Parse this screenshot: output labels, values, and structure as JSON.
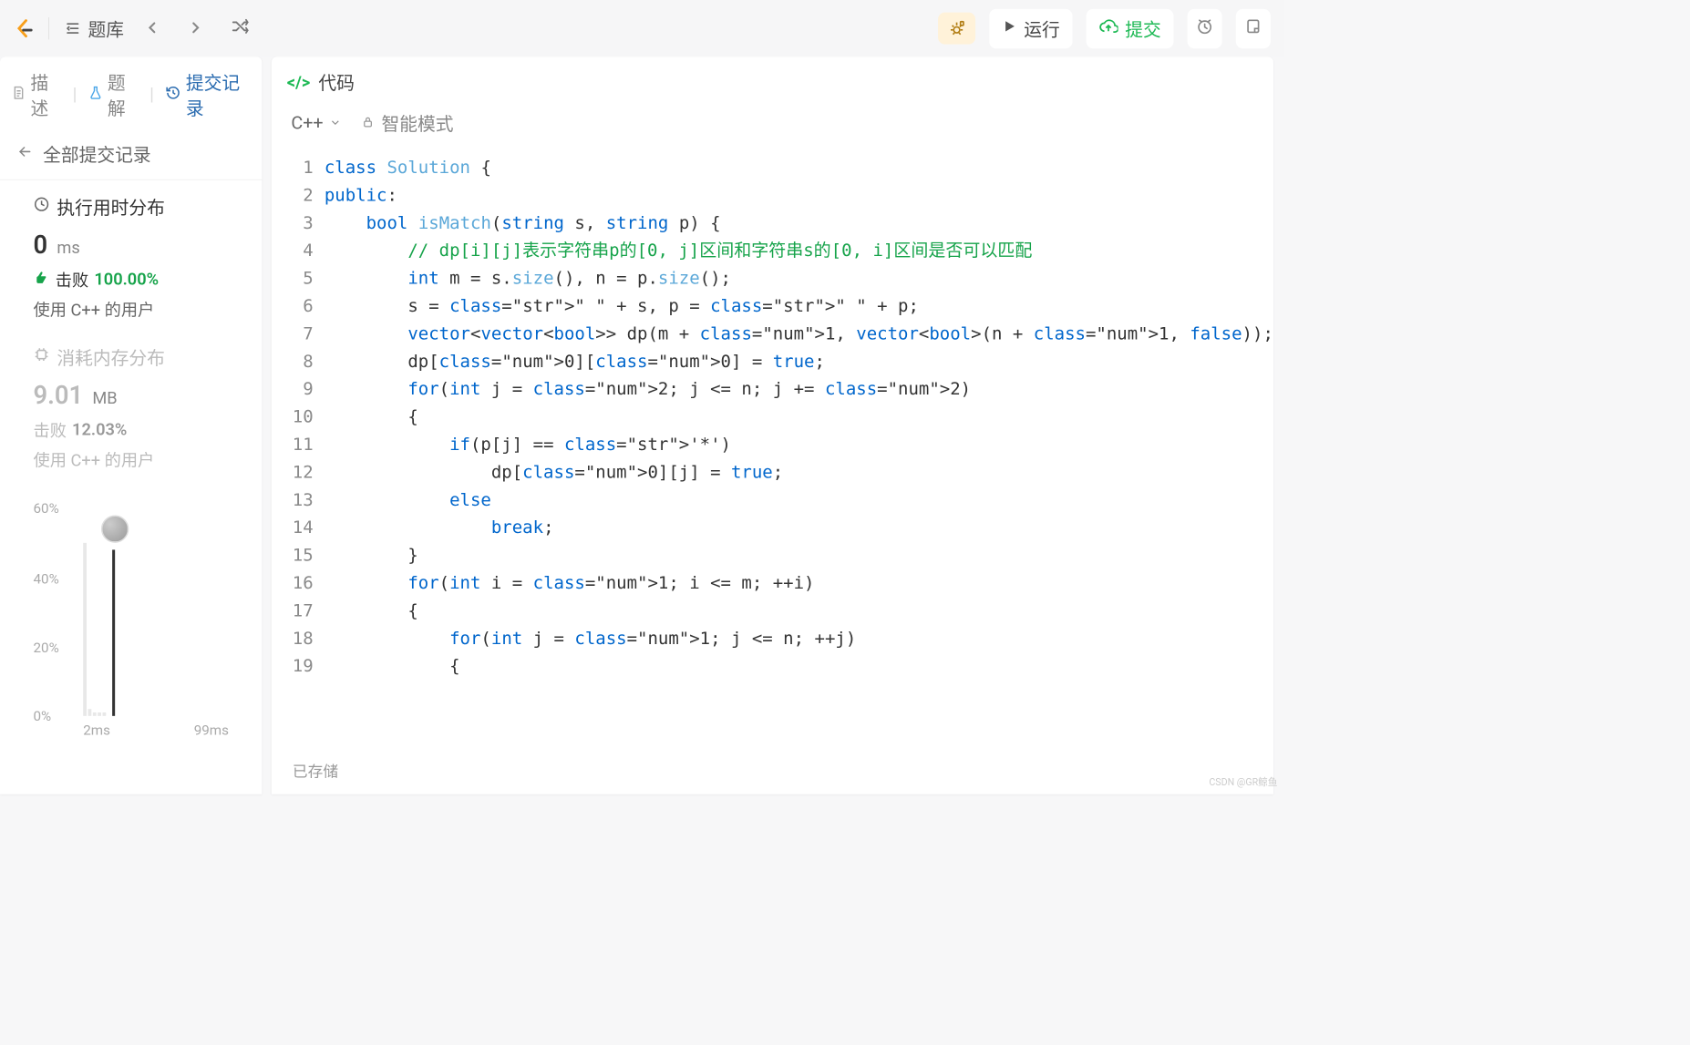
{
  "toolbar": {
    "problemset_label": "题库",
    "run_label": "运行",
    "submit_label": "提交"
  },
  "tabs": {
    "desc": "描述",
    "solution": "题解",
    "history": "提交记录"
  },
  "subheader": {
    "back_label": "全部提交记录"
  },
  "runtime": {
    "title": "执行用时分布",
    "value": "0",
    "unit": "ms",
    "beat_prefix": "击败",
    "beat_pct": "100.00%",
    "beat_suffix": "使用 C++ 的用户"
  },
  "memory": {
    "title": "消耗内存分布",
    "value": "9.01",
    "unit": "MB",
    "beat_prefix": "击败",
    "beat_pct": "12.03%",
    "beat_suffix": "使用 C++ 的用户"
  },
  "chart_data": {
    "type": "bar",
    "categories": [
      "2ms",
      "99ms"
    ],
    "values": [
      50,
      2,
      1,
      1,
      1,
      0,
      0,
      0,
      0,
      0,
      0,
      0,
      0,
      0,
      0,
      0,
      0,
      0,
      0,
      0,
      0,
      0,
      0,
      0,
      0,
      0,
      0,
      0,
      0,
      0
    ],
    "title": "执行用时分布",
    "xlabel": "",
    "ylabel": "",
    "ylim": [
      0,
      60
    ],
    "yticks": [
      "0%",
      "20%",
      "40%",
      "60%"
    ],
    "marker": {
      "x": "2ms",
      "pct": 50
    }
  },
  "code_panel": {
    "header": "代码",
    "language": "C++",
    "mode": "智能模式",
    "status": "已存储"
  },
  "code": {
    "lines": [
      {
        "n": 1,
        "plain": "class Solution {"
      },
      {
        "n": 2,
        "plain": "public:"
      },
      {
        "n": 3,
        "plain": "    bool isMatch(string s, string p) {"
      },
      {
        "n": 4,
        "plain": "        // dp[i][j]表示字符串p的[0, j]区间和字符串s的[0, i]区间是否可以匹配"
      },
      {
        "n": 5,
        "plain": "        int m = s.size(), n = p.size();"
      },
      {
        "n": 6,
        "plain": "        s = \" \" + s, p = \" \" + p;"
      },
      {
        "n": 7,
        "plain": "        vector<vector<bool>> dp(m + 1, vector<bool>(n + 1, false));"
      },
      {
        "n": 8,
        "plain": "        dp[0][0] = true;"
      },
      {
        "n": 9,
        "plain": "        for(int j = 2; j <= n; j += 2)"
      },
      {
        "n": 10,
        "plain": "        {"
      },
      {
        "n": 11,
        "plain": "            if(p[j] == '*')"
      },
      {
        "n": 12,
        "plain": "                dp[0][j] = true;"
      },
      {
        "n": 13,
        "plain": "            else"
      },
      {
        "n": 14,
        "plain": "                break;"
      },
      {
        "n": 15,
        "plain": "        }"
      },
      {
        "n": 16,
        "plain": "        for(int i = 1; i <= m; ++i)"
      },
      {
        "n": 17,
        "plain": "        {"
      },
      {
        "n": 18,
        "plain": "            for(int j = 1; j <= n; ++j)"
      },
      {
        "n": 19,
        "plain": "            {"
      }
    ]
  },
  "watermark": "CSDN @GR鲸鱼"
}
